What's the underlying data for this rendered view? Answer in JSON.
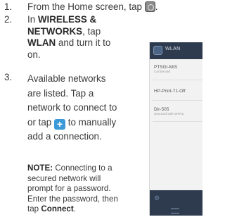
{
  "steps": [
    {
      "num": "1.",
      "lines": [
        "From the Home screen, tap"
      ]
    },
    {
      "num": "2.",
      "lines": [
        "In",
        "WIRELESS &",
        "NETWORKS",
        ", tap",
        "WLAN",
        "and turn it to",
        "on."
      ]
    },
    {
      "num": "3.",
      "lines": [
        "Available networks",
        "are listed. Tap a",
        "network to connect to",
        "or tap",
        "to manually",
        "add a connection."
      ]
    }
  ],
  "note": {
    "label": "NOTE:",
    "line1": "Connecting to a",
    "line2": "secured network will",
    "line3": "prompt for a password.",
    "line4": "Enter the password, then",
    "line5_pre": "tap",
    "line5_bold": "Connect",
    "line5_post": "."
  },
  "phone": {
    "title": "WLAN",
    "networks": [
      {
        "name": "PTSGI-MIS",
        "status": "Connected"
      },
      {
        "name": "HP-Print-71-Off",
        "status": ""
      },
      {
        "name": "Dir-505",
        "status": "Secured with WPA2"
      }
    ]
  },
  "icons": {
    "home": "home-screen-icon",
    "add": "plus-icon",
    "settings": "gear-icon",
    "menu": "menu-icon"
  },
  "colors": {
    "text": "#3a3a3a",
    "plus_bg": "#3d9ad8",
    "phone_bar": "#2e3b4e"
  }
}
